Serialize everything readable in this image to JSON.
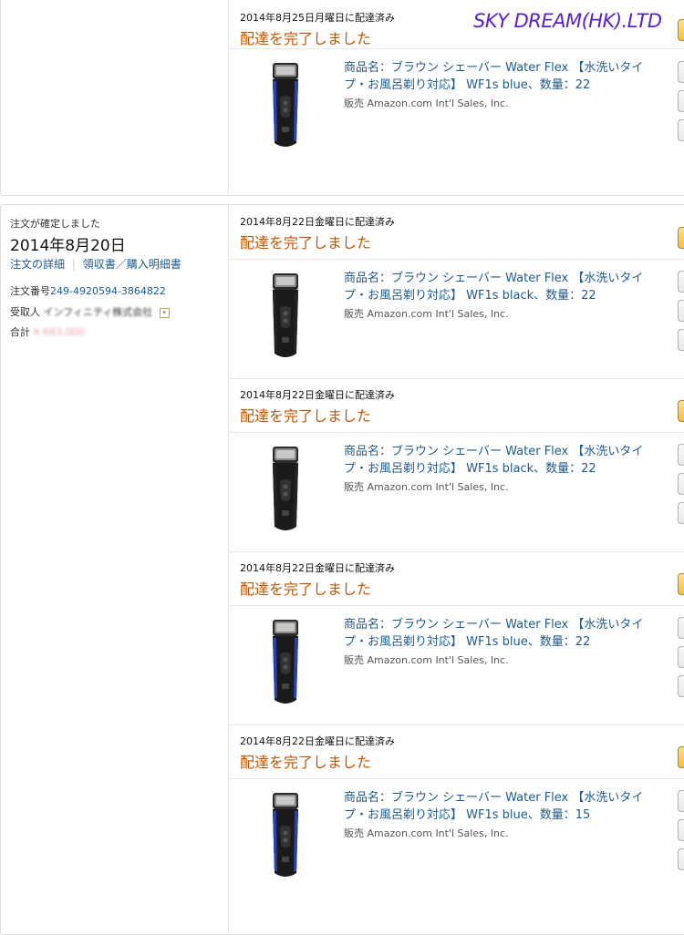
{
  "watermark": "SKY DREAM(HK).LTD",
  "order": {
    "confirmed_label": "注文が確定しました",
    "date": "2014年8月20日",
    "details_link": "注文の詳細",
    "separator": "|",
    "receipt_link": "領収書／購入明細書",
    "order_number_label": "注文番号",
    "order_number": "249-4920594-3864822",
    "recipient_label": "受取人",
    "recipient_name": "インフィニティ株式会社",
    "total_label": "合計",
    "total_value": "¥ 693,000"
  },
  "shipments": [
    {
      "delivered": "2014年8月25日月曜日に配達済み",
      "status": "配達を完了しました",
      "title": "商品名：ブラウン シェーバー Water Flex 【水洗いタイプ・お風呂剃り対応】 WF1s blue、数量：22",
      "seller": "販売 Amazon.com Int'l Sales, Inc.",
      "color": "blue"
    },
    {
      "delivered": "2014年8月22日金曜日に配達済み",
      "status": "配達を完了しました",
      "title": "商品名：ブラウン シェーバー Water Flex 【水洗いタイプ・お風呂剃り対応】 WF1s black、数量：22",
      "seller": "販売 Amazon.com Int'l Sales, Inc.",
      "color": "black"
    },
    {
      "delivered": "2014年8月22日金曜日に配達済み",
      "status": "配達を完了しました",
      "title": "商品名：ブラウン シェーバー Water Flex 【水洗いタイプ・お風呂剃り対応】 WF1s black、数量：22",
      "seller": "販売 Amazon.com Int'l Sales, Inc.",
      "color": "black"
    },
    {
      "delivered": "2014年8月22日金曜日に配達済み",
      "status": "配達を完了しました",
      "title": "商品名：ブラウン シェーバー Water Flex 【水洗いタイプ・お風呂剃り対応】 WF1s blue、数量：22",
      "seller": "販売 Amazon.com Int'l Sales, Inc.",
      "color": "blue"
    },
    {
      "delivered": "2014年8月22日金曜日に配達済み",
      "status": "配達を完了しました",
      "title": "商品名：ブラウン シェーバー Water Flex 【水洗いタイプ・お風呂剃り対応】 WF1s blue、数量：15",
      "seller": "販売 Amazon.com Int'l Sales, Inc.",
      "color": "blue"
    }
  ],
  "colors": {
    "status": "#c45500",
    "link": "#1f5a8c",
    "watermark": "#5b1fc8",
    "shaver_blue_accent": "#2a3fb0",
    "shaver_black_accent": "#222222"
  }
}
